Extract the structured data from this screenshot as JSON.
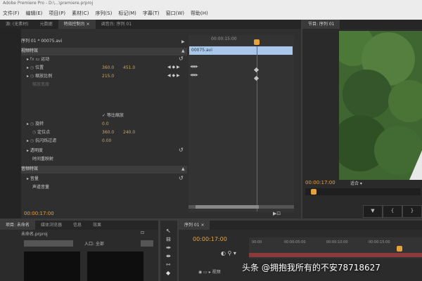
{
  "app": {
    "title": "Adobe Premiere Pro - D:\\...\\premiere.prproj",
    "menu": [
      "文件(F)",
      "编辑(E)",
      "项目(P)",
      "素材(C)",
      "序列(S)",
      "标记(M)",
      "字幕(T)",
      "窗口(W)",
      "帮助(H)"
    ]
  },
  "effect_controls": {
    "tabs": [
      "源: (无素材)",
      "元数据",
      "特效控制台 ×",
      "调音台: 序列 01"
    ],
    "source_label": "序列 01 * 00075.avi",
    "clip_name": "00075.avi",
    "timecode_ruler": "00:00:15:00",
    "section_video": "视频特效",
    "section_audio": "音频特效",
    "motion": "运动",
    "rows": [
      {
        "label": "位置",
        "v1": "360.0",
        "v2": "451.0"
      },
      {
        "label": "缩放比例",
        "v1": "215.0",
        "v2": ""
      },
      {
        "label": "缩放宽度",
        "v1": "",
        "v2": ""
      },
      {
        "label": "等比缩放",
        "v1": "",
        "v2": ""
      },
      {
        "label": "旋转",
        "v1": "0.0",
        "v2": ""
      },
      {
        "label": "定位点",
        "v1": "360.0",
        "v2": "240.0"
      },
      {
        "label": "抗闪烁过滤",
        "v1": "0.00",
        "v2": ""
      }
    ],
    "opacity": "透明度",
    "time_remap": "时间重映射",
    "volume": "音量",
    "channel": "声道音量",
    "timecode": "00:00:17:00"
  },
  "program_monitor": {
    "tab": "节目: 序列 01",
    "timecode": "00:00:17:00",
    "fit": "适合"
  },
  "project": {
    "tabs": [
      "项目: 未命名",
      "媒体浏览器",
      "信息",
      "效果"
    ],
    "filename": "未命名.prproj",
    "inpoint_label": "入口: 全部"
  },
  "timeline": {
    "tab": "序列 01 ×",
    "timecode": "00:00:17:00",
    "ruler": [
      "00:00",
      "00:00:05:00",
      "00:00:10:00",
      "00:00:15:00"
    ],
    "track": "视频"
  },
  "watermark": "头条 @拥抱我所有的不安78718627",
  "colors": {
    "accent_orange": "#e8a23a",
    "playhead": "#d04030",
    "clip_blue": "#a9c7ea"
  }
}
